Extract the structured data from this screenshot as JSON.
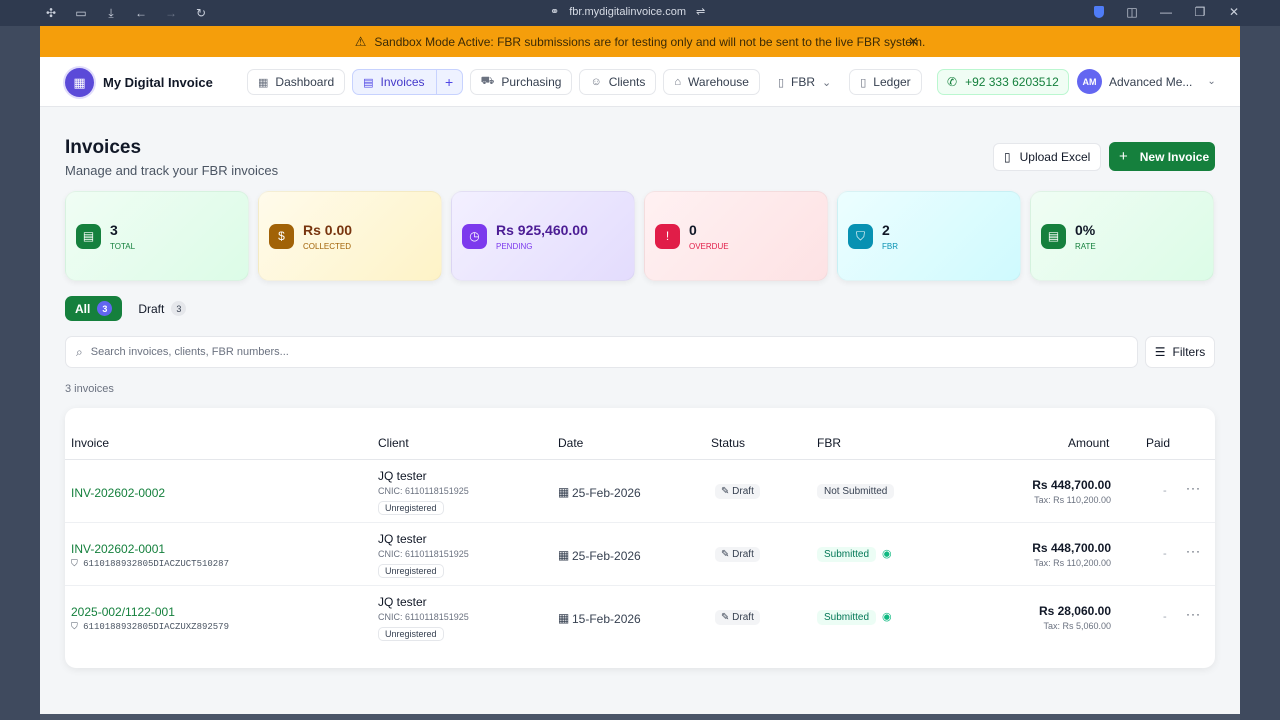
{
  "browser": {
    "url": "fbr.mydigitalinvoice.com"
  },
  "banner": {
    "icon": "warning-icon",
    "text": "Sandbox Mode Active: FBR submissions are for testing only and will not be sent to the live FBR system.",
    "close": "✕"
  },
  "nav": {
    "brand": "My Digital Invoice",
    "items": [
      {
        "label": "Dashboard",
        "icon": "grid-icon"
      },
      {
        "label": "Invoices",
        "icon": "document-icon"
      },
      {
        "label": "Purchasing",
        "icon": "cart-icon"
      },
      {
        "label": "Clients",
        "icon": "users-icon"
      },
      {
        "label": "Warehouse",
        "icon": "warehouse-icon"
      },
      {
        "label": "FBR",
        "icon": "file-icon"
      },
      {
        "label": "Ledger",
        "icon": "book-icon"
      }
    ],
    "phone": "+92 333 6203512",
    "user_initials": "AM",
    "user_name": "Advanced Me..."
  },
  "header": {
    "title": "Invoices",
    "subtitle": "Manage and track your FBR invoices",
    "upload_label": "Upload Excel",
    "new_label": "New Invoice"
  },
  "stats": [
    {
      "value": "3",
      "label": "TOTAL",
      "icon": "document-icon",
      "color": "#15803d"
    },
    {
      "value": "Rs 0.00",
      "label": "COLLECTED",
      "icon": "dollar-icon",
      "color": "#a16207"
    },
    {
      "value": "Rs 925,460.00",
      "label": "PENDING",
      "icon": "clock-icon",
      "color": "#7c3aed"
    },
    {
      "value": "0",
      "label": "OVERDUE",
      "icon": "alert-icon",
      "color": "#e11d48"
    },
    {
      "value": "2",
      "label": "FBR",
      "icon": "shield-icon",
      "color": "#0891b2"
    },
    {
      "value": "0%",
      "label": "RATE",
      "icon": "receipt-icon",
      "color": "#15803d"
    }
  ],
  "tabs": {
    "all_label": "All",
    "all_count": "3",
    "draft_label": "Draft",
    "draft_count": "3"
  },
  "search": {
    "placeholder": "Search invoices, clients, FBR numbers...",
    "filters_label": "Filters"
  },
  "count_text": "3 invoices",
  "table": {
    "headers": {
      "invoice": "Invoice",
      "client": "Client",
      "date": "Date",
      "status": "Status",
      "fbr": "FBR",
      "amount": "Amount",
      "paid": "Paid"
    },
    "rows": [
      {
        "invoice": "INV-202602-0002",
        "fbr_number": "",
        "client": "JQ tester",
        "cnic": "CNIC: 6110118151925",
        "registration": "Unregistered",
        "date": "25-Feb-2026",
        "status": "Draft",
        "fbr_status": "Not Submitted",
        "amount": "Rs 448,700.00",
        "tax": "Tax: Rs 110,200.00",
        "paid": "-"
      },
      {
        "invoice": "INV-202602-0001",
        "fbr_number": "6110188932805DIACZUCT510287",
        "client": "JQ tester",
        "cnic": "CNIC: 6110118151925",
        "registration": "Unregistered",
        "date": "25-Feb-2026",
        "status": "Draft",
        "fbr_status": "Submitted",
        "amount": "Rs 448,700.00",
        "tax": "Tax: Rs 110,200.00",
        "paid": "-"
      },
      {
        "invoice": "2025-002/1122-001",
        "fbr_number": "6110188932805DIACZUXZ892579",
        "client": "JQ tester",
        "cnic": "CNIC: 6110118151925",
        "registration": "Unregistered",
        "date": "15-Feb-2026",
        "status": "Draft",
        "fbr_status": "Submitted",
        "amount": "Rs 28,060.00",
        "tax": "Tax: Rs 5,060.00",
        "paid": "-"
      }
    ]
  }
}
